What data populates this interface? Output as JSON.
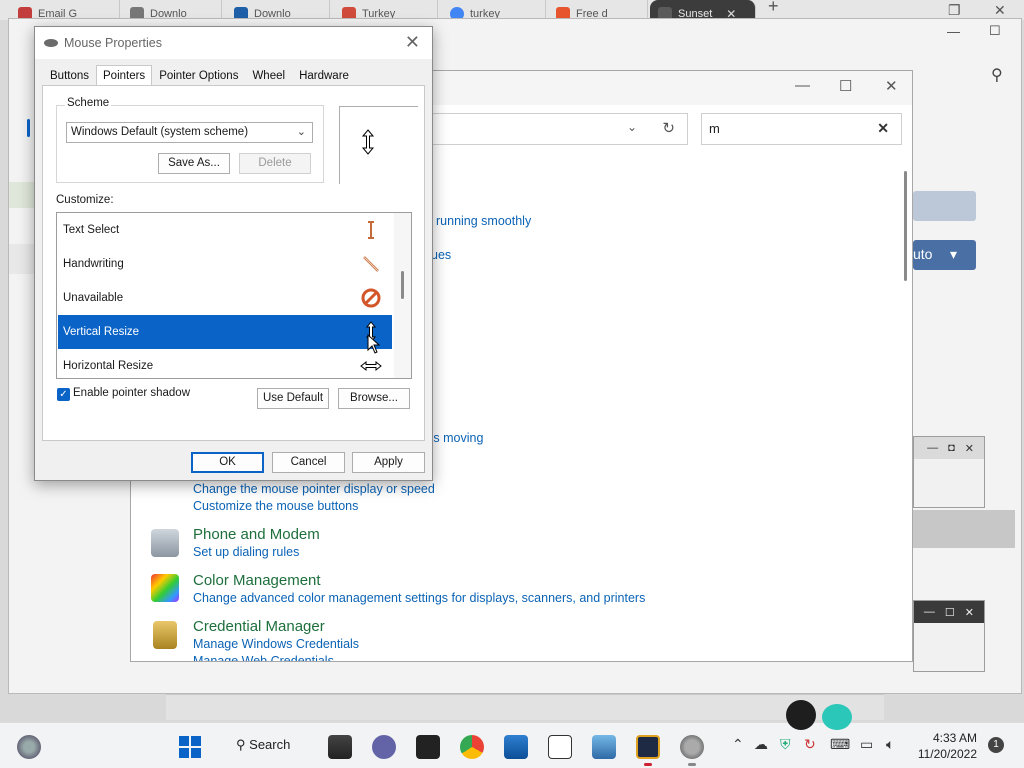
{
  "browser": {
    "tabs": [
      {
        "label": "Email G",
        "color": "#c43d3d"
      },
      {
        "label": "Downlo",
        "color": "#555555"
      },
      {
        "label": "Downlo",
        "color": "#1f5fa8"
      },
      {
        "label": "Turkey",
        "color": "#d14b3c"
      },
      {
        "label": "turkey",
        "color": "#4285f4"
      },
      {
        "label": "Free d",
        "color": "#e6552d"
      },
      {
        "label": "Sunset",
        "color": "#2e2e2e"
      }
    ]
  },
  "control_panel": {
    "search_value": "m",
    "partial_links": [
      "running smoothly",
      "ues",
      "'s moving"
    ],
    "partial_button": "uto",
    "mouse_links": [
      "Change the mouse pointer display or speed",
      "Customize the mouse buttons"
    ],
    "sections": [
      {
        "title": "Phone and Modem",
        "links": [
          "Set up dialing rules"
        ],
        "icon": "phone-modem-icon"
      },
      {
        "title": "Color Management",
        "links": [
          "Change advanced color management settings for displays, scanners, and printers"
        ],
        "icon": "color-management-icon"
      },
      {
        "title": "Credential Manager",
        "links": [
          "Manage Windows Credentials",
          "Manage Web Credentials"
        ],
        "icon": "credential-manager-icon"
      }
    ]
  },
  "dialog": {
    "title": "Mouse Properties",
    "tabs": [
      "Buttons",
      "Pointers",
      "Pointer Options",
      "Wheel",
      "Hardware"
    ],
    "active_tab": "Pointers",
    "scheme_label": "Scheme",
    "scheme_value": "Windows Default (system scheme)",
    "save_as": "Save As...",
    "delete": "Delete",
    "customize_label": "Customize:",
    "pointers": [
      {
        "label": "Text Select",
        "icon": "text-select-cursor-icon"
      },
      {
        "label": "Handwriting",
        "icon": "handwriting-cursor-icon"
      },
      {
        "label": "Unavailable",
        "icon": "unavailable-cursor-icon"
      },
      {
        "label": "Vertical Resize",
        "icon": "vertical-resize-cursor-icon",
        "selected": true
      },
      {
        "label": "Horizontal Resize",
        "icon": "horizontal-resize-cursor-icon"
      }
    ],
    "shadow_label": "Enable pointer shadow",
    "shadow_checked": true,
    "use_default": "Use Default",
    "browse": "Browse...",
    "ok": "OK",
    "cancel": "Cancel",
    "apply": "Apply"
  },
  "taskbar": {
    "search": "Search",
    "time": "4:33 AM",
    "date": "11/20/2022",
    "notifications": "1"
  },
  "colors": {
    "selection": "#0a64c8",
    "link": "#0b63b5",
    "heading": "#1e6f3c"
  }
}
